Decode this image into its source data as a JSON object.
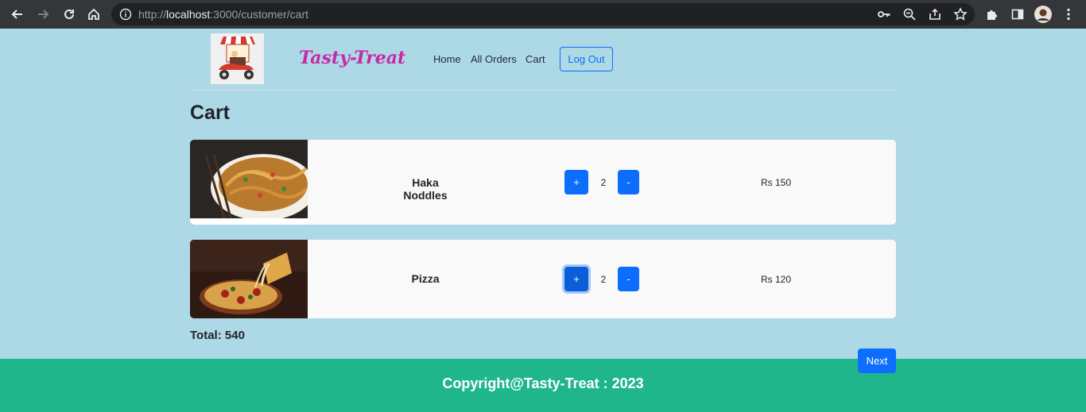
{
  "browser": {
    "url_prefix": "http://",
    "url_host": "localhost",
    "url_path": ":3000/customer/cart"
  },
  "navbar": {
    "brand": "Tasty-Treat",
    "links": [
      "Home",
      "All Orders",
      "Cart"
    ],
    "logout_label": "Log Out"
  },
  "page_title": "Cart",
  "cart": {
    "items": [
      {
        "name": "Haka Noddles",
        "plus_label": "+",
        "quantity": "2",
        "minus_label": "-",
        "price": "Rs 150"
      },
      {
        "name": "Pizza",
        "plus_label": "+",
        "quantity": "2",
        "minus_label": "-",
        "price": "Rs 120"
      }
    ],
    "total": "Total: 540",
    "next_label": "Next"
  },
  "footer": {
    "copyright": "Copyright@Tasty-Treat : 2023"
  },
  "colors": {
    "page_bg": "#add8e6",
    "brand": "#c62aa6",
    "primary": "#0d6efd",
    "footer_bg": "#20b68c"
  }
}
